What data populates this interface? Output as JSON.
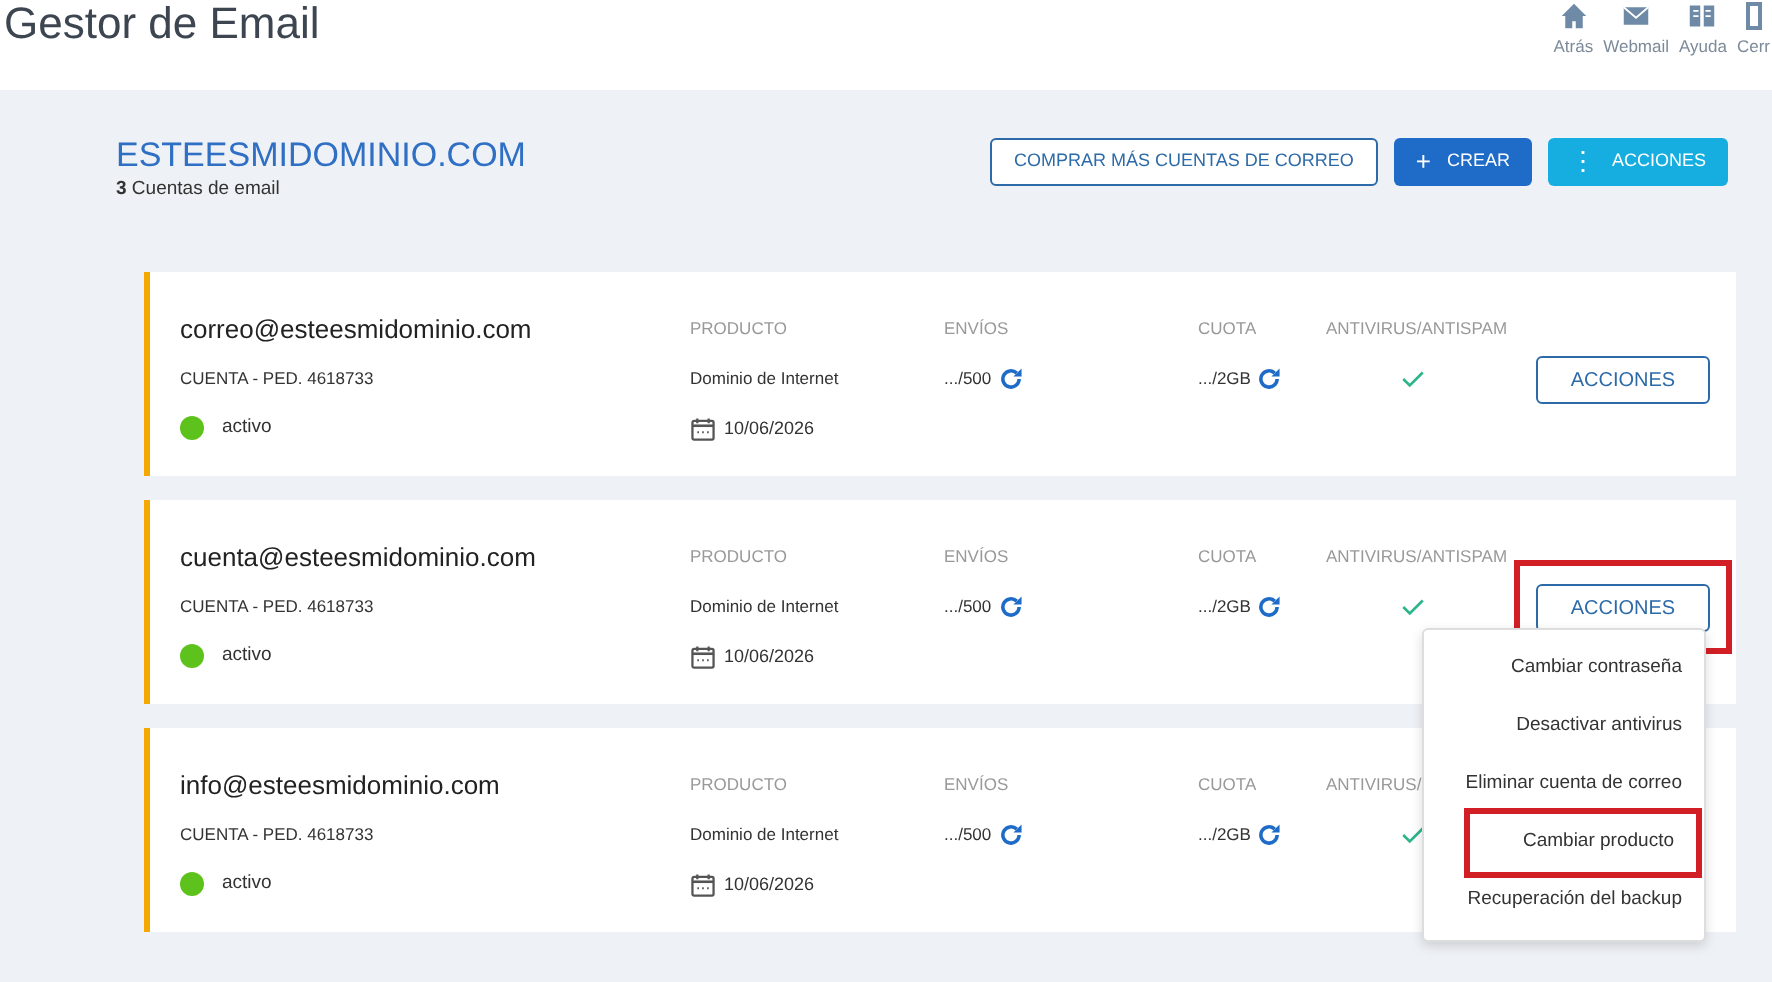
{
  "header": {
    "title": "Gestor de Email",
    "nav": [
      {
        "kind": "home",
        "label": "Atrás"
      },
      {
        "kind": "mail",
        "label": "Webmail"
      },
      {
        "kind": "book",
        "label": "Ayuda"
      },
      {
        "kind": "exit",
        "label": "Cerr"
      }
    ]
  },
  "domain": {
    "name": "ESTEESMIDOMINIO.COM",
    "count": "3",
    "count_label": "Cuentas de email"
  },
  "toolbar": [
    {
      "kind": "outline",
      "label": "COMPRAR MÁS CUENTAS DE CORREO"
    },
    {
      "kind": "create",
      "icon": "+",
      "label": "CREAR"
    },
    {
      "kind": "actions",
      "icon": "⋮",
      "label": "ACCIONES"
    }
  ],
  "accounts": [
    {
      "email": "correo@esteesmidominio.com",
      "account": "CUENTA - PED. 4618733",
      "status": "activo",
      "product_label": "PRODUCTO",
      "product": "Dominio de Internet",
      "date": "10/06/2026",
      "sends_label": "ENVÍOS",
      "sends": ".../500",
      "quota_label": "CUOTA",
      "quota": ".../2GB",
      "antivirus_label": "ANTIVIRUS/ANTISPAM",
      "antivirus_on": true,
      "actions": {
        "label": "ACCIONES",
        "highlighted": false
      }
    },
    {
      "email": "cuenta@esteesmidominio.com",
      "account": "CUENTA - PED. 4618733",
      "status": "activo",
      "product_label": "PRODUCTO",
      "product": "Dominio de Internet",
      "date": "10/06/2026",
      "sends_label": "ENVÍOS",
      "sends": ".../500",
      "quota_label": "CUOTA",
      "quota": ".../2GB",
      "antivirus_label": "ANTIVIRUS/ANTISPAM",
      "antivirus_on": true,
      "actions": {
        "label": "ACCIONES",
        "highlighted": true
      }
    },
    {
      "email": "info@esteesmidominio.com",
      "account": "CUENTA - PED. 4618733",
      "status": "activo",
      "product_label": "PRODUCTO",
      "product": "Dominio de Internet",
      "date": "10/06/2026",
      "sends_label": "ENVÍOS",
      "sends": ".../500",
      "quota_label": "CUOTA",
      "quota": ".../2GB",
      "antivirus_label": "ANTIVIRUS/",
      "antivirus_on": true
    }
  ],
  "menu": [
    {
      "label": "Cambiar contraseña",
      "highlighted": false
    },
    {
      "label": "Desactivar antivirus",
      "highlighted": false
    },
    {
      "label": "Eliminar cuenta de correo",
      "highlighted": false
    },
    {
      "label": "Cambiar producto",
      "highlighted": true
    },
    {
      "label": "Recuperación del backup",
      "highlighted": false
    }
  ]
}
